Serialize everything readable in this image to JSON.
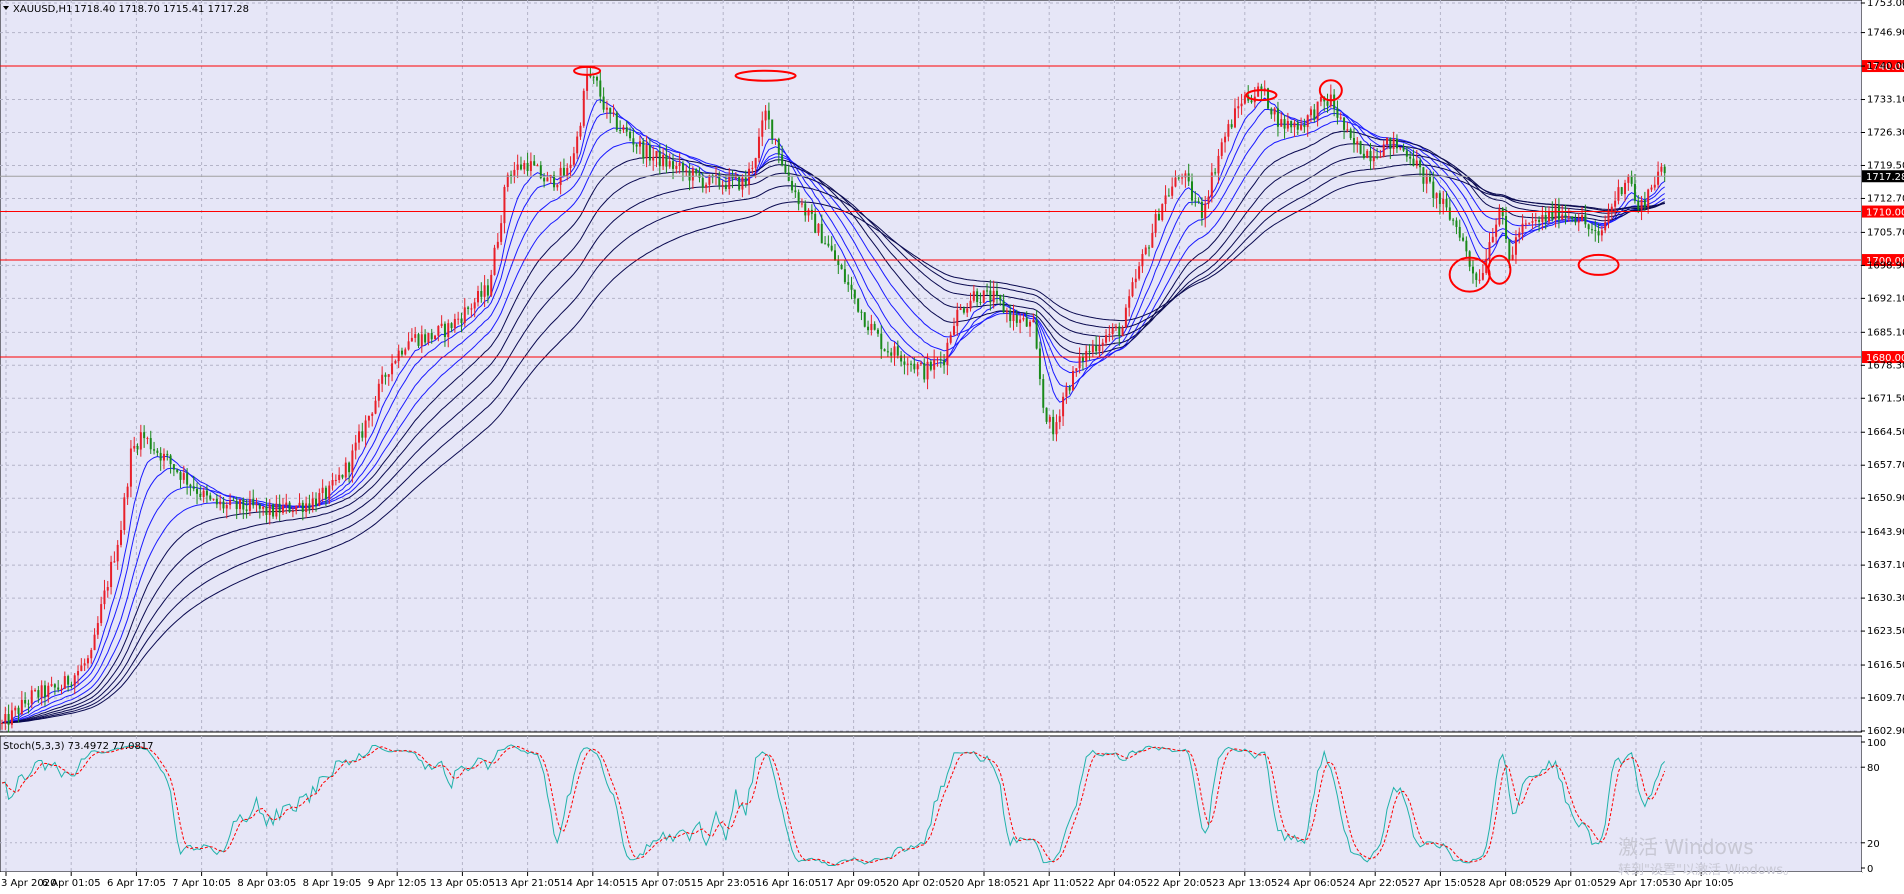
{
  "header": {
    "symbol": "XAUUSD,H1",
    "ohlc": "1718.40 1718.70 1715.41 1717.28"
  },
  "colors": {
    "background": "#e6e6f7",
    "grid": "#b4b4c8",
    "bull_candle": "#e8202a",
    "bear_candle": "#1a8a1a",
    "ma_fast": "#1a1aff",
    "ma_slow": "#0a0a50",
    "hline": "#ff0000",
    "stoch_main": "#20b2aa",
    "stoch_signal": "#ff0000"
  },
  "stoch_header": "Stoch(5,3,3) 73.4972 77.0817",
  "watermark": {
    "line1": "激活 Windows",
    "line2": "转到\"设置\"以激活 Windows。"
  },
  "chart_data": {
    "type": "candlestick",
    "instrument": "XAUUSD",
    "timeframe": "H1",
    "ylim": [
      1602.9,
      1753.0
    ],
    "y_ticks": [
      "1753.00",
      "1746.90",
      "1740.00",
      "1733.10",
      "1726.30",
      "1719.50",
      "1712.70",
      "1705.70",
      "1698.90",
      "1692.10",
      "1685.10",
      "1678.30",
      "1671.50",
      "1664.50",
      "1657.70",
      "1650.90",
      "1643.90",
      "1637.10",
      "1630.30",
      "1623.50",
      "1616.50",
      "1609.70",
      "1602.90"
    ],
    "x_ticks": [
      "3 Apr 2020",
      "6 Apr 01:05",
      "6 Apr 17:05",
      "7 Apr 10:05",
      "8 Apr 03:05",
      "8 Apr 19:05",
      "9 Apr 12:05",
      "13 Apr 05:05",
      "13 Apr 21:05",
      "14 Apr 14:05",
      "15 Apr 07:05",
      "15 Apr 23:05",
      "16 Apr 16:05",
      "17 Apr 09:05",
      "20 Apr 02:05",
      "20 Apr 18:05",
      "21 Apr 11:05",
      "22 Apr 04:05",
      "22 Apr 20:05",
      "23 Apr 13:05",
      "24 Apr 06:05",
      "24 Apr 22:05",
      "27 Apr 15:05",
      "28 Apr 08:05",
      "29 Apr 01:05",
      "29 Apr 17:05",
      "30 Apr 10:05"
    ],
    "current_price": "1717.28",
    "horizontal_lines": [
      {
        "value": 1740.0,
        "label": "1740.00"
      },
      {
        "value": 1710.0,
        "label": "1710.00"
      },
      {
        "value": 1700.0,
        "label": "1700.00"
      },
      {
        "value": 1680.0,
        "label": "1680.00"
      }
    ],
    "price_path": [
      [
        0,
        1604
      ],
      [
        3,
        1610
      ],
      [
        6,
        1612
      ],
      [
        9,
        1618
      ],
      [
        10,
        1628
      ],
      [
        12,
        1645
      ],
      [
        13,
        1660
      ],
      [
        14,
        1664
      ],
      [
        16,
        1660
      ],
      [
        18,
        1656
      ],
      [
        20,
        1652
      ],
      [
        21,
        1650
      ],
      [
        23,
        1649
      ],
      [
        25,
        1649
      ],
      [
        27,
        1648
      ],
      [
        29,
        1649
      ],
      [
        31,
        1650
      ],
      [
        33,
        1652
      ],
      [
        35,
        1658
      ],
      [
        37,
        1668
      ],
      [
        39,
        1678
      ],
      [
        41,
        1684
      ],
      [
        43,
        1684
      ],
      [
        45,
        1686
      ],
      [
        47,
        1690
      ],
      [
        49,
        1694
      ],
      [
        50,
        1705
      ],
      [
        51,
        1718
      ],
      [
        53,
        1720
      ],
      [
        55,
        1716
      ],
      [
        57,
        1718
      ],
      [
        58,
        1725
      ],
      [
        59,
        1738
      ],
      [
        60,
        1736
      ],
      [
        61,
        1730
      ],
      [
        63,
        1726
      ],
      [
        65,
        1722
      ],
      [
        67,
        1720
      ],
      [
        69,
        1718
      ],
      [
        71,
        1716
      ],
      [
        73,
        1716
      ],
      [
        75,
        1716
      ],
      [
        76,
        1722
      ],
      [
        77,
        1730
      ],
      [
        78,
        1725
      ],
      [
        79,
        1718
      ],
      [
        80,
        1714
      ],
      [
        81,
        1710
      ],
      [
        83,
        1704
      ],
      [
        85,
        1696
      ],
      [
        87,
        1688
      ],
      [
        89,
        1682
      ],
      [
        91,
        1680
      ],
      [
        93,
        1677
      ],
      [
        95,
        1680
      ],
      [
        96,
        1688
      ],
      [
        98,
        1693
      ],
      [
        100,
        1692
      ],
      [
        102,
        1688
      ],
      [
        104,
        1686
      ],
      [
        105,
        1670
      ],
      [
        106,
        1664
      ],
      [
        107,
        1672
      ],
      [
        109,
        1680
      ],
      [
        111,
        1684
      ],
      [
        113,
        1686
      ],
      [
        114,
        1694
      ],
      [
        115,
        1700
      ],
      [
        117,
        1712
      ],
      [
        119,
        1718
      ],
      [
        120,
        1713
      ],
      [
        121,
        1710
      ],
      [
        123,
        1724
      ],
      [
        125,
        1733
      ],
      [
        127,
        1735
      ],
      [
        129,
        1728
      ],
      [
        131,
        1728
      ],
      [
        133,
        1732
      ],
      [
        134,
        1733
      ],
      [
        136,
        1724
      ],
      [
        138,
        1722
      ],
      [
        140,
        1724
      ],
      [
        142,
        1722
      ],
      [
        143,
        1718
      ],
      [
        145,
        1712
      ],
      [
        147,
        1706
      ],
      [
        148,
        1699
      ],
      [
        149,
        1696
      ],
      [
        150,
        1704
      ],
      [
        151,
        1711
      ],
      [
        152,
        1700
      ],
      [
        153,
        1706
      ],
      [
        155,
        1708
      ],
      [
        157,
        1710
      ],
      [
        159,
        1709
      ],
      [
        161,
        1704
      ],
      [
        162,
        1710
      ],
      [
        163,
        1714
      ],
      [
        164,
        1718
      ],
      [
        165,
        1710
      ],
      [
        166,
        1714
      ],
      [
        167,
        1718
      ],
      [
        168,
        1717
      ]
    ],
    "moving_averages": {
      "count": 9,
      "note": "ribbon of moving averages, blue shades"
    },
    "annotations": [
      {
        "type": "ellipse",
        "at": 59,
        "price": 1739
      },
      {
        "type": "ellipse",
        "at": 77,
        "price": 1738
      },
      {
        "type": "ellipse",
        "at": 127,
        "price": 1734
      },
      {
        "type": "ellipse",
        "at": 134,
        "price": 1735
      },
      {
        "type": "ellipse",
        "at": 148,
        "price": 1697
      },
      {
        "type": "ellipse",
        "at": 151,
        "price": 1698
      },
      {
        "type": "ellipse",
        "at": 161,
        "price": 1699
      }
    ],
    "stochastic": {
      "params": "5,3,3",
      "main": 73.4972,
      "signal": 77.0817,
      "ylim": [
        0,
        100
      ],
      "y_ticks": [
        "100",
        "80",
        "20",
        "0"
      ]
    }
  }
}
